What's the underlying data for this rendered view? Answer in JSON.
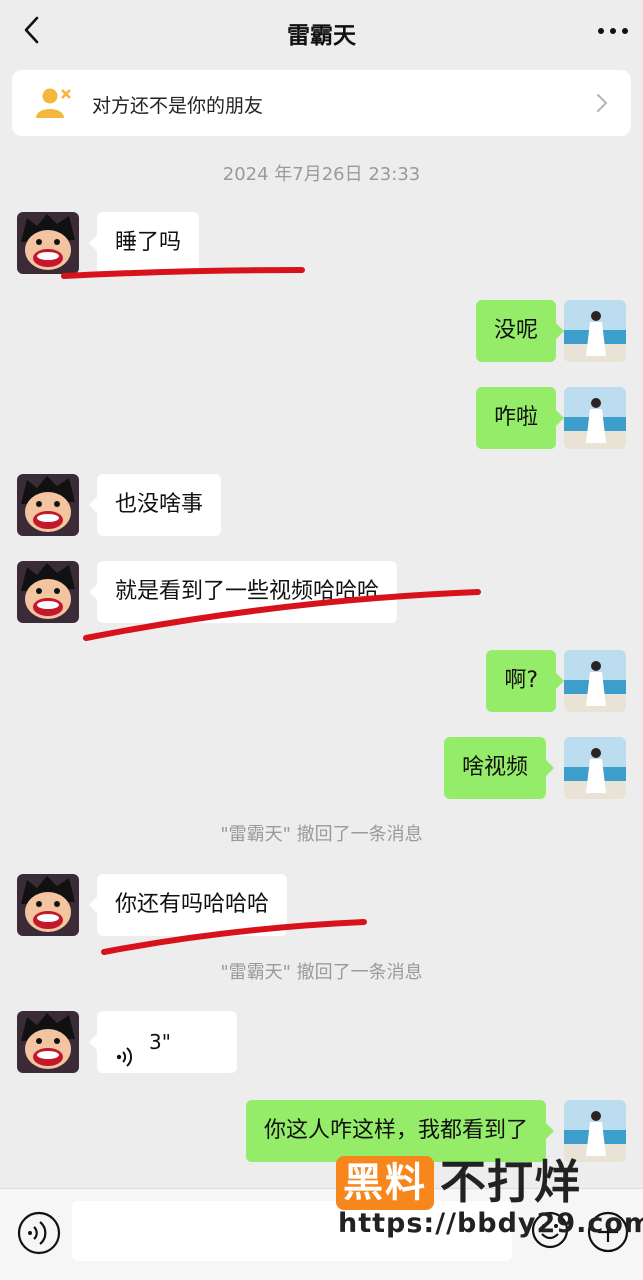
{
  "header": {
    "title": "雷霸天"
  },
  "banner": {
    "text": "对方还不是你的朋友"
  },
  "timestamp": "2024 年7月26日 23:33",
  "messages": [
    {
      "from": "them",
      "text": "睡了吗"
    },
    {
      "from": "me",
      "text": "没呢"
    },
    {
      "from": "me",
      "text": "咋啦"
    },
    {
      "from": "them",
      "text": "也没啥事"
    },
    {
      "from": "them",
      "text": "就是看到了一些视频哈哈哈"
    },
    {
      "from": "me",
      "text": "啊?"
    },
    {
      "from": "me",
      "text": "啥视频"
    },
    {
      "from": "them",
      "text": "你还有吗哈哈哈"
    },
    {
      "from": "them",
      "type": "voice",
      "duration": "3\""
    },
    {
      "from": "me",
      "text": "你这人咋这样，我都看到了"
    }
  ],
  "system_messages": [
    "\"雷霸天\" 撤回了一条消息",
    "\"雷霸天\" 撤回了一条消息"
  ],
  "watermark": {
    "badge": "黑料",
    "text": "不打烊",
    "url": "https://bbdy29.com"
  },
  "colors": {
    "outgoing_bubble": "#95ec69",
    "incoming_bubble": "#ffffff",
    "strike": "#d8121a",
    "watermark": "#f7861c"
  },
  "icons": [
    "back-icon",
    "more-icon",
    "add-friend-icon",
    "chevron-right-icon",
    "voice-wave-icon",
    "voice-input-icon",
    "emoji-icon",
    "plus-icon"
  ]
}
